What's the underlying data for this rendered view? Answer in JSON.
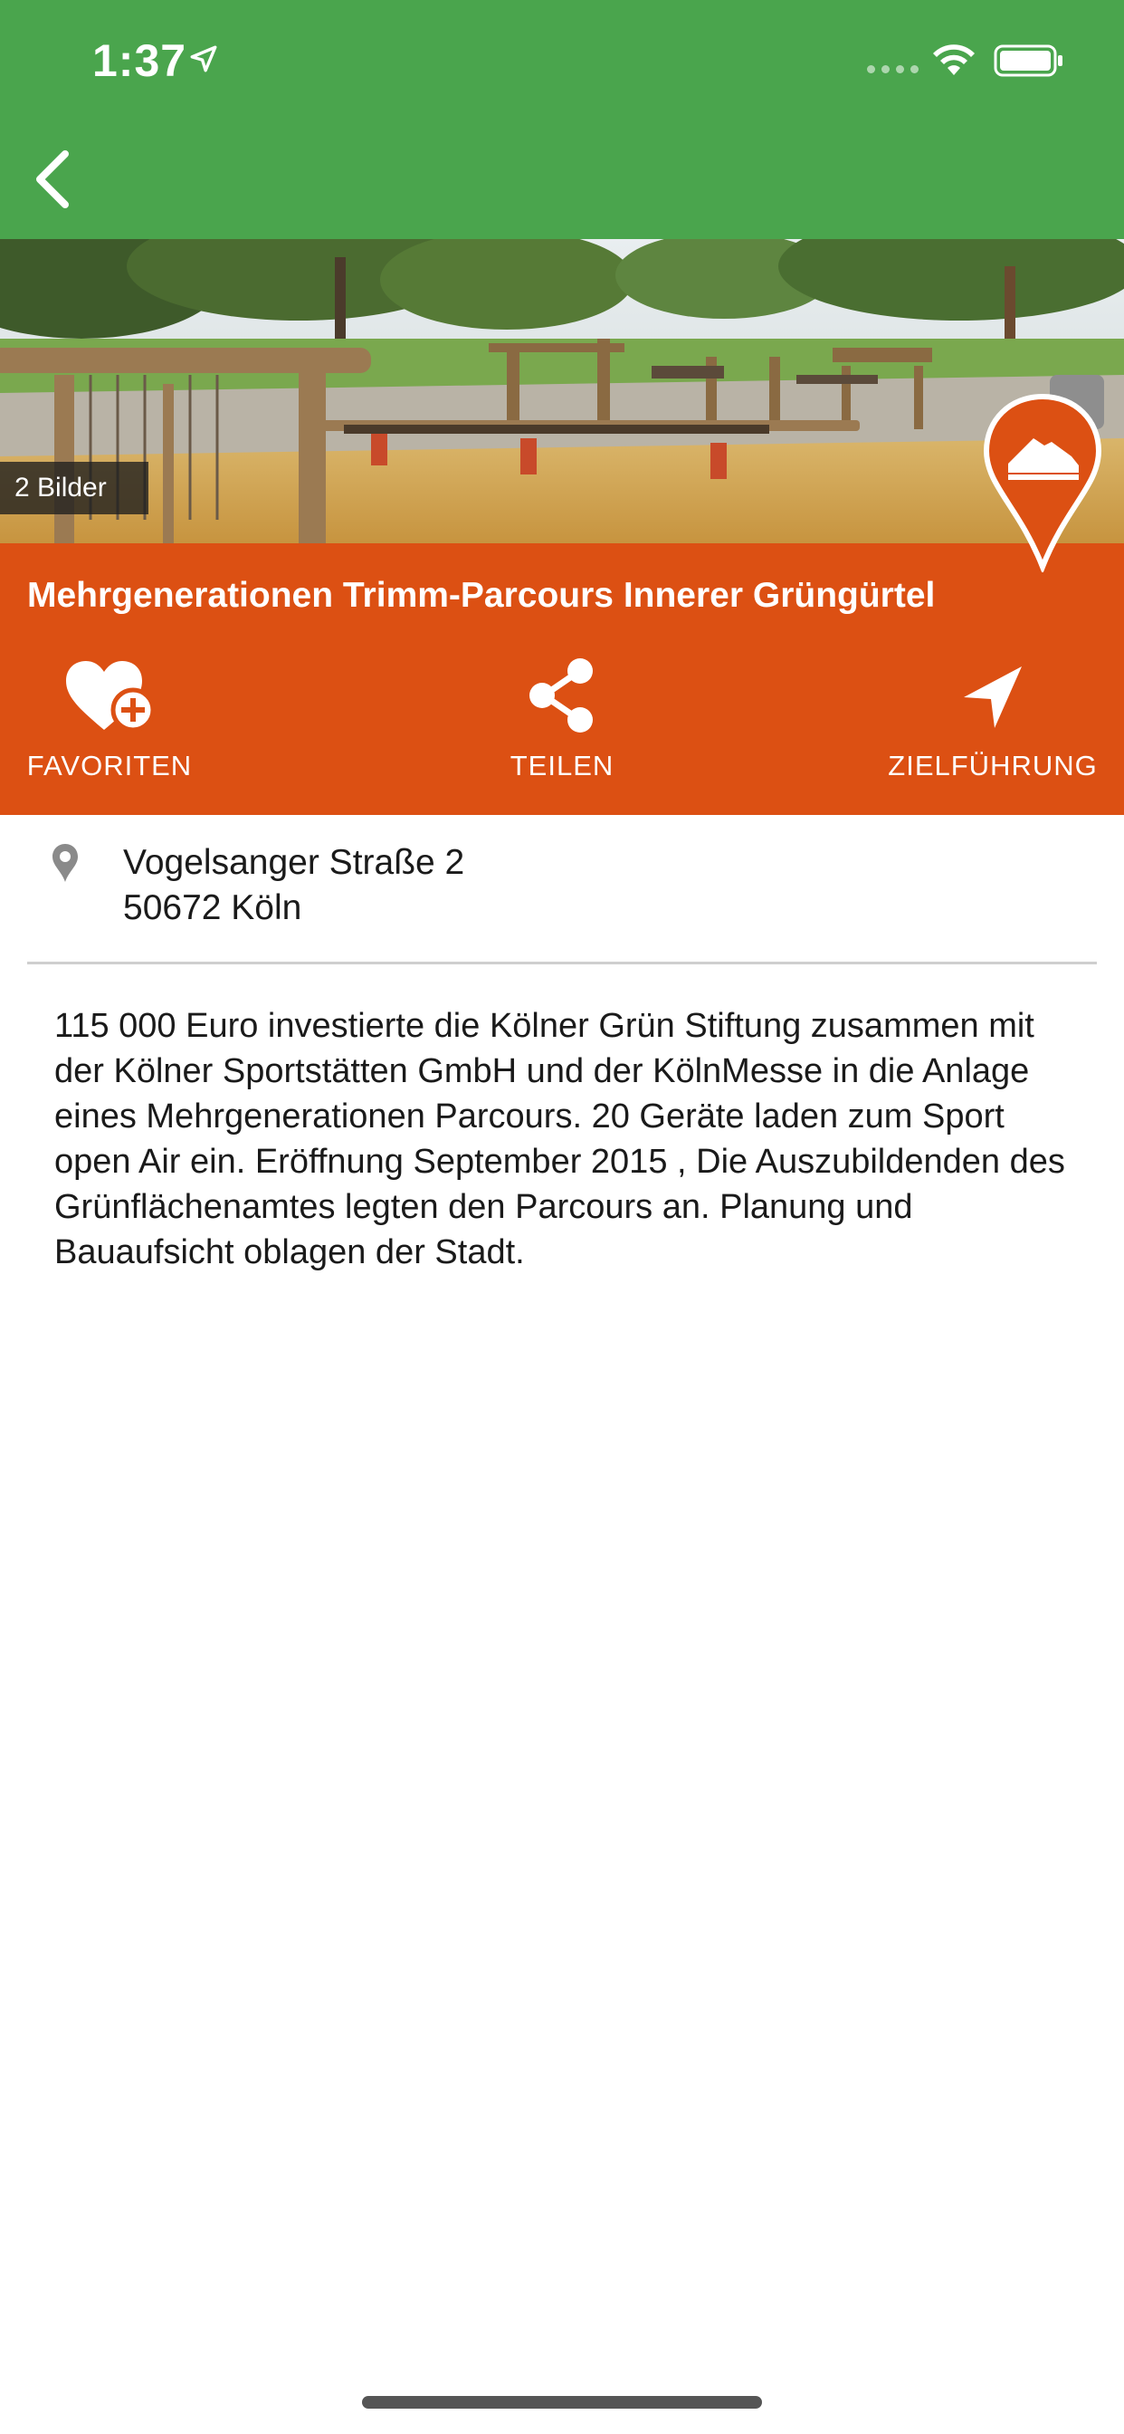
{
  "status": {
    "time": "1:37"
  },
  "nav": {
    "back_icon": "chevron-left-icon",
    "bar_color": "#4aa54d"
  },
  "hero": {
    "photo_count": "2 Bilder",
    "category_icon": "running-shoe-icon"
  },
  "place": {
    "title": "Mehrgenerationen Trimm-Parcours Innerer Grüngürtel",
    "accent_color": "#dc5013"
  },
  "actions": {
    "favorites": {
      "label": "FAVORITEN",
      "icon": "heart-plus-icon"
    },
    "share": {
      "label": "TEILEN",
      "icon": "share-icon"
    },
    "route": {
      "label": "ZIELFÜHRUNG",
      "icon": "navigation-arrow-icon"
    }
  },
  "address": {
    "street": "Vogelsanger Straße 2",
    "city": "50672 Köln",
    "icon": "map-pin-icon"
  },
  "description": {
    "text": "115 000 Euro investierte die Kölner Grün Stiftung zusammen mit der Kölner Sportstätten GmbH und der KölnMesse in die Anlage eines Mehrgenerationen Parcours. 20 Geräte laden zum Sport open Air ein. Eröffnung September 2015 , Die Auszubildenden des Grünflächenamtes legten den Parcours an. Planung und Bauaufsicht oblagen der Stadt."
  }
}
